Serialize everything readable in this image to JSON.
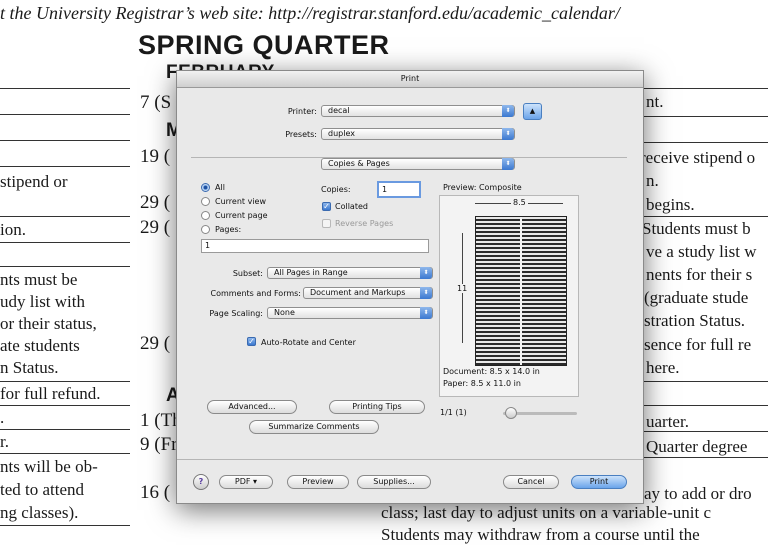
{
  "background": {
    "top_line": "t the University Registrar’s web site: http://registrar.stanford.edu/academic_calendar/",
    "heading": "SPRING QUARTER",
    "month1": "FEBRUARY",
    "month2": "M",
    "month3": "A",
    "left_lines": [
      "stipend or",
      "ion.",
      "nts must be",
      "udy list with",
      "or their status,",
      "ate students",
      "n Status.",
      "for full refund.",
      ".",
      "r.",
      "nts will be ob-",
      "ted to attend",
      "ng classes)."
    ],
    "dates": [
      "7 (S",
      "19 (",
      "29 (",
      "29 (",
      "29 (",
      "1 (Th",
      "9 (Fr",
      "16 ("
    ],
    "right_lines": [
      "nt.",
      "receive stipend o",
      "n.",
      "begins.",
      "Students must b",
      "ve a study list w",
      "nents for their s",
      "(graduate stude",
      "stration Status.",
      "sence for full re",
      "here.",
      "uarter.",
      "Quarter degree",
      "ay to add or dro"
    ],
    "bottom_lines": [
      "class; last day to adjust units on a variable-unit c",
      "Students may withdraw from a course until the"
    ]
  },
  "dialog": {
    "title": "Print",
    "printer_label": "Printer:",
    "printer_value": "decal",
    "presets_label": "Presets:",
    "presets_value": "duplex",
    "pane_value": "Copies & Pages",
    "pages_options": [
      "All",
      "Current view",
      "Current page",
      "Pages:"
    ],
    "pages_selected": "All",
    "pages_field_value": "1",
    "copies_label": "Copies:",
    "copies_value": "1",
    "collated_label": "Collated",
    "collated_checked": true,
    "reverse_label": "Reverse Pages",
    "reverse_checked": false,
    "preview_label": "Preview: Composite",
    "width_label": "8.5",
    "height_label": "11",
    "document_size": "Document: 8.5 x 14.0 in",
    "paper_size": "Paper: 8.5 x 11.0 in",
    "page_count": "1/1 (1)",
    "subset_label": "Subset:",
    "subset_value": "All Pages in Range",
    "comments_label": "Comments and Forms:",
    "comments_value": "Document and Markups",
    "scaling_label": "Page Scaling:",
    "scaling_value": "None",
    "autorotate_label": "Auto-Rotate and Center",
    "autorotate_checked": true,
    "advanced_label": "Advanced...",
    "printing_tips_label": "Printing Tips",
    "summarize_label": "Summarize Comments",
    "help_label": "?",
    "pdf_label": "PDF ▾",
    "preview_button_label": "Preview",
    "supplies_label": "Supplies...",
    "cancel_label": "Cancel",
    "print_label": "Print",
    "arrow_glyph": "⬍",
    "expand_glyph": "▲"
  }
}
